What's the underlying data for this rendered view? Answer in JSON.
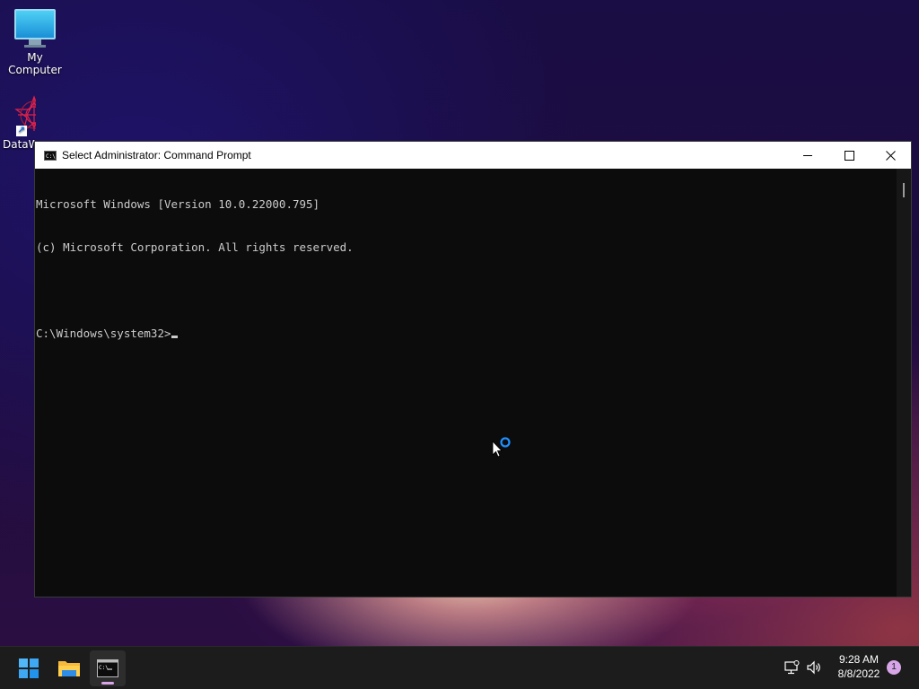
{
  "desktop": {
    "icons": [
      {
        "label": "My Computer",
        "icon": "monitor-icon"
      },
      {
        "label": "DataW",
        "icon": "datawatch-logo-icon"
      }
    ]
  },
  "window": {
    "title": "Select Administrator: Command Prompt",
    "icon": "cmd-icon",
    "controls": {
      "minimize": "minimize-icon",
      "maximize": "maximize-icon",
      "close": "close-icon"
    }
  },
  "console": {
    "lines": [
      "Microsoft Windows [Version 10.0.22000.795]",
      "(c) Microsoft Corporation. All rights reserved.",
      "",
      "C:\\Windows\\system32>"
    ]
  },
  "taskbar": {
    "items": [
      {
        "name": "start",
        "icon": "windows-logo-icon"
      },
      {
        "name": "file-explorer",
        "icon": "folder-icon"
      },
      {
        "name": "command-prompt",
        "icon": "cmd-icon",
        "active": true
      }
    ],
    "tray": {
      "network_icon": "network-icon",
      "volume_icon": "volume-icon",
      "time": "9:28 AM",
      "date": "8/8/2022",
      "notification_count": "1"
    }
  },
  "colors": {
    "console_bg": "#0c0c0c",
    "console_fg": "#cccccc",
    "taskbar_bg": "#1c1c1c",
    "accent": "#d8a6e8"
  }
}
